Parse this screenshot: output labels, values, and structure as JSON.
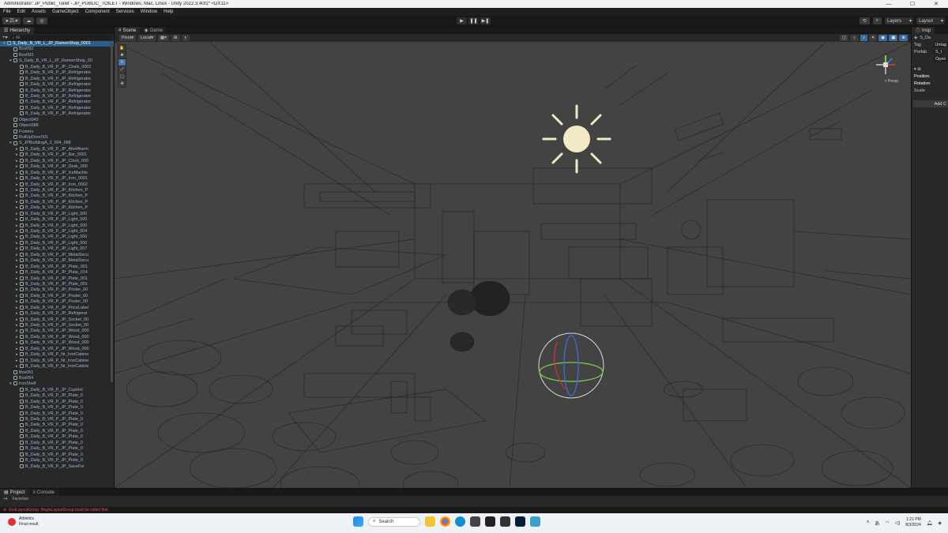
{
  "window": {
    "title": "Administrator: JP_Public_Toilet - JP_PUBLIC_TOILET - Windows, Mac, Linux - Unity 2022.3.40f1* <DX11>",
    "minimize": "—",
    "maximize": "☐",
    "close": "✕"
  },
  "menu": [
    "File",
    "Edit",
    "Assets",
    "GameObject",
    "Component",
    "Services",
    "Window",
    "Help"
  ],
  "toolbar": {
    "account": "ZL",
    "layers_label": "Layers",
    "layout_label": "Layout"
  },
  "hierarchy": {
    "tab": "Hierarchy",
    "search": "All",
    "rows": [
      {
        "text": "S_Daily_B_VR_L_JP_RamenShop_0001",
        "depth": 0,
        "arrow": "▾",
        "sel": true
      },
      {
        "text": "Box092",
        "depth": 1,
        "arrow": "",
        "sel": false
      },
      {
        "text": "Box093",
        "depth": 1,
        "arrow": "",
        "sel": false
      },
      {
        "text": "S_Daily_B_VR_L_JP_RamenShop_00",
        "depth": 1,
        "arrow": "▾",
        "sel": false
      },
      {
        "text": "B_Daily_B_VR_P_JP_Chalk_0002",
        "depth": 2,
        "arrow": "",
        "sel": false
      },
      {
        "text": "B_Daily_B_VR_P_JP_Refrigerator",
        "depth": 2,
        "arrow": "",
        "sel": false
      },
      {
        "text": "B_Daily_B_VR_P_JP_Refrigerator",
        "depth": 2,
        "arrow": "",
        "sel": false
      },
      {
        "text": "B_Daily_B_VR_P_JP_Refrigerator",
        "depth": 2,
        "arrow": "",
        "sel": false
      },
      {
        "text": "B_Daily_B_VR_P_JP_Refrigerator",
        "depth": 2,
        "arrow": "",
        "sel": false
      },
      {
        "text": "B_Daily_B_VR_P_JP_Refrigerator",
        "depth": 2,
        "arrow": "",
        "sel": false
      },
      {
        "text": "B_Daily_B_VR_P_JP_Refrigerator",
        "depth": 2,
        "arrow": "",
        "sel": false
      },
      {
        "text": "B_Daily_B_VR_P_JP_Refrigerator",
        "depth": 2,
        "arrow": "",
        "sel": false
      },
      {
        "text": "B_Daily_B_VR_P_JP_Refrigerator",
        "depth": 2,
        "arrow": "",
        "sel": false
      },
      {
        "text": "Object043",
        "depth": 1,
        "arrow": "",
        "sel": false
      },
      {
        "text": "Object088",
        "depth": 1,
        "arrow": "",
        "sel": false
      },
      {
        "text": "Posters",
        "depth": 1,
        "arrow": "",
        "sel": false
      },
      {
        "text": "RollUpDoor001",
        "depth": 1,
        "arrow": "",
        "sel": false
      },
      {
        "text": "S_JPBuildingA_2_004_088",
        "depth": 1,
        "arrow": "▾",
        "sel": false
      },
      {
        "text": "B_Daily_B_VR_P_JP_AlertAlarm",
        "depth": 2,
        "arrow": "▸",
        "sel": false
      },
      {
        "text": "B_Daily_B_VR_P_JP_Bar_0001",
        "depth": 2,
        "arrow": "▸",
        "sel": false
      },
      {
        "text": "B_Daily_B_VR_P_JP_Clock_000",
        "depth": 2,
        "arrow": "▸",
        "sel": false
      },
      {
        "text": "B_Daily_B_VR_P_JP_Desk_000",
        "depth": 2,
        "arrow": "▸",
        "sel": false
      },
      {
        "text": "B_Daily_B_VR_P_JP_IceMachin",
        "depth": 2,
        "arrow": "▸",
        "sel": false
      },
      {
        "text": "B_Daily_B_VR_P_JP_Iron_0001",
        "depth": 2,
        "arrow": "▸",
        "sel": false
      },
      {
        "text": "B_Daily_B_VR_P_JP_Iron_0002",
        "depth": 2,
        "arrow": "▸",
        "sel": false
      },
      {
        "text": "B_Daily_B_VR_P_JP_Kitchen_P",
        "depth": 2,
        "arrow": "▸",
        "sel": false
      },
      {
        "text": "B_Daily_B_VR_P_JP_Kitchen_P",
        "depth": 2,
        "arrow": "▸",
        "sel": false
      },
      {
        "text": "B_Daily_B_VR_P_JP_Kitchen_P",
        "depth": 2,
        "arrow": "▸",
        "sel": false
      },
      {
        "text": "B_Daily_B_VR_P_JP_Kitchen_P",
        "depth": 2,
        "arrow": "▸",
        "sel": false
      },
      {
        "text": "B_Daily_B_VR_P_JP_Light_000",
        "depth": 2,
        "arrow": "▸",
        "sel": false
      },
      {
        "text": "B_Daily_B_VR_P_JP_Light_000",
        "depth": 2,
        "arrow": "▸",
        "sel": false
      },
      {
        "text": "B_Daily_B_VR_P_JP_Light_000",
        "depth": 2,
        "arrow": "▸",
        "sel": false
      },
      {
        "text": "B_Daily_B_VR_P_JP_Light_004",
        "depth": 2,
        "arrow": "▸",
        "sel": false
      },
      {
        "text": "B_Daily_B_VR_P_JP_Light_000",
        "depth": 2,
        "arrow": "▸",
        "sel": false
      },
      {
        "text": "B_Daily_B_VR_P_JP_Light_000",
        "depth": 2,
        "arrow": "▸",
        "sel": false
      },
      {
        "text": "B_Daily_B_VR_P_JP_Light_007",
        "depth": 2,
        "arrow": "▸",
        "sel": false
      },
      {
        "text": "B_Daily_B_VR_P_JP_MetalSecu",
        "depth": 2,
        "arrow": "▸",
        "sel": false
      },
      {
        "text": "B_Daily_B_VR_P_JP_MetalSecu",
        "depth": 2,
        "arrow": "▸",
        "sel": false
      },
      {
        "text": "B_Daily_B_VR_P_JP_Plate_001",
        "depth": 2,
        "arrow": "▸",
        "sel": false
      },
      {
        "text": "B_Daily_B_VR_P_JP_Plate_014",
        "depth": 2,
        "arrow": "▸",
        "sel": false
      },
      {
        "text": "B_Daily_B_VR_P_JP_Plate_001",
        "depth": 2,
        "arrow": "▸",
        "sel": false
      },
      {
        "text": "B_Daily_B_VR_P_JP_Plate_001",
        "depth": 2,
        "arrow": "▸",
        "sel": false
      },
      {
        "text": "B_Daily_B_VR_P_JP_Poster_00",
        "depth": 2,
        "arrow": "▸",
        "sel": false
      },
      {
        "text": "B_Daily_B_VR_P_JP_Poster_00",
        "depth": 2,
        "arrow": "▸",
        "sel": false
      },
      {
        "text": "B_Daily_B_VR_P_JP_Poster_00",
        "depth": 2,
        "arrow": "▸",
        "sel": false
      },
      {
        "text": "B_Daily_B_VR_P_JP_PriceLabel",
        "depth": 2,
        "arrow": "▸",
        "sel": false
      },
      {
        "text": "B_Daily_B_VR_P_JP_Refrigerat",
        "depth": 2,
        "arrow": "▸",
        "sel": false
      },
      {
        "text": "B_Daily_B_VR_P_JP_Socket_00",
        "depth": 2,
        "arrow": "▸",
        "sel": false
      },
      {
        "text": "B_Daily_B_VR_P_JP_Socket_00",
        "depth": 2,
        "arrow": "▸",
        "sel": false
      },
      {
        "text": "B_Daily_B_VR_P_JP_Wood_000",
        "depth": 2,
        "arrow": "▸",
        "sel": false
      },
      {
        "text": "B_Daily_B_VR_P_JP_Wood_000",
        "depth": 2,
        "arrow": "▸",
        "sel": false
      },
      {
        "text": "B_Daily_B_VR_P_JP_Wood_000",
        "depth": 2,
        "arrow": "▸",
        "sel": false
      },
      {
        "text": "B_Daily_B_VR_P_JP_Wood_000",
        "depth": 2,
        "arrow": "▸",
        "sel": false
      },
      {
        "text": "B_Daily_B_VR_P_Nr_IronCabine",
        "depth": 2,
        "arrow": "▸",
        "sel": false
      },
      {
        "text": "B_Daily_B_VR_P_Nr_IronCabine",
        "depth": 2,
        "arrow": "▸",
        "sel": false
      },
      {
        "text": "B_Daily_B_VR_P_Nr_IronCabine",
        "depth": 2,
        "arrow": "▸",
        "sel": false
      },
      {
        "text": "Box051",
        "depth": 1,
        "arrow": "",
        "sel": false
      },
      {
        "text": "Box054",
        "depth": 1,
        "arrow": "",
        "sel": false
      },
      {
        "text": "IronShelf",
        "depth": 1,
        "arrow": "▾",
        "sel": false
      },
      {
        "text": "B_Daily_B_VR_P_JP_CupHol",
        "depth": 2,
        "arrow": "",
        "sel": false
      },
      {
        "text": "B_Daily_B_VR_P_JP_Plate_0",
        "depth": 2,
        "arrow": "",
        "sel": false
      },
      {
        "text": "B_Daily_B_VR_P_JP_Plate_0",
        "depth": 2,
        "arrow": "",
        "sel": false
      },
      {
        "text": "B_Daily_B_VR_P_JP_Plate_0",
        "depth": 2,
        "arrow": "",
        "sel": false
      },
      {
        "text": "B_Daily_B_VR_P_JP_Plate_0",
        "depth": 2,
        "arrow": "",
        "sel": false
      },
      {
        "text": "B_Daily_B_VR_P_JP_Plate_0",
        "depth": 2,
        "arrow": "",
        "sel": false
      },
      {
        "text": "B_Daily_B_VR_P_JP_Plate_0",
        "depth": 2,
        "arrow": "",
        "sel": false
      },
      {
        "text": "B_Daily_B_VR_P_JP_Plate_0",
        "depth": 2,
        "arrow": "",
        "sel": false
      },
      {
        "text": "B_Daily_B_VR_P_JP_Plate_0",
        "depth": 2,
        "arrow": "",
        "sel": false
      },
      {
        "text": "B_Daily_B_VR_P_JP_Plate_0",
        "depth": 2,
        "arrow": "",
        "sel": false
      },
      {
        "text": "B_Daily_B_VR_P_JP_Plate_0",
        "depth": 2,
        "arrow": "",
        "sel": false
      },
      {
        "text": "B_Daily_B_VR_P_JP_Plate_0",
        "depth": 2,
        "arrow": "",
        "sel": false
      },
      {
        "text": "B_Daily_B_VR_P_JP_Plate_0",
        "depth": 2,
        "arrow": "",
        "sel": false
      },
      {
        "text": "B_Daily_B_VR_P_JP_SaveFor",
        "depth": 2,
        "arrow": "",
        "sel": false
      }
    ]
  },
  "scene": {
    "tab_scene": "Scene",
    "tab_game": "Game",
    "pivot": "Pivot",
    "local": "Local",
    "persp": "< Persp"
  },
  "inspector": {
    "tab": "Insp",
    "name": "S_Da",
    "tag_label": "Tag",
    "tag_value": "Untag",
    "prefab_label": "Prefab",
    "prefab_value": "S_I",
    "prefab_open": "Open",
    "transform": {
      "position": "Position",
      "rotation": "Rotation",
      "scale": "Scale"
    },
    "add_component": "Add C"
  },
  "bottom": {
    "tab_project": "Project",
    "tab_console": "Console",
    "console_line": "Favorites",
    "error": "EndLayoutGroup: BeginLayoutGroup must be called first."
  },
  "taskbar": {
    "weather_title": "Athletics",
    "weather_sub": "Final result",
    "search": "Search",
    "time": "1:21 PM",
    "date": "8/3/2024"
  },
  "colors": {
    "sun": "#f3e9c6",
    "selection": "#2c5d87",
    "accent": "#3d6da0"
  }
}
